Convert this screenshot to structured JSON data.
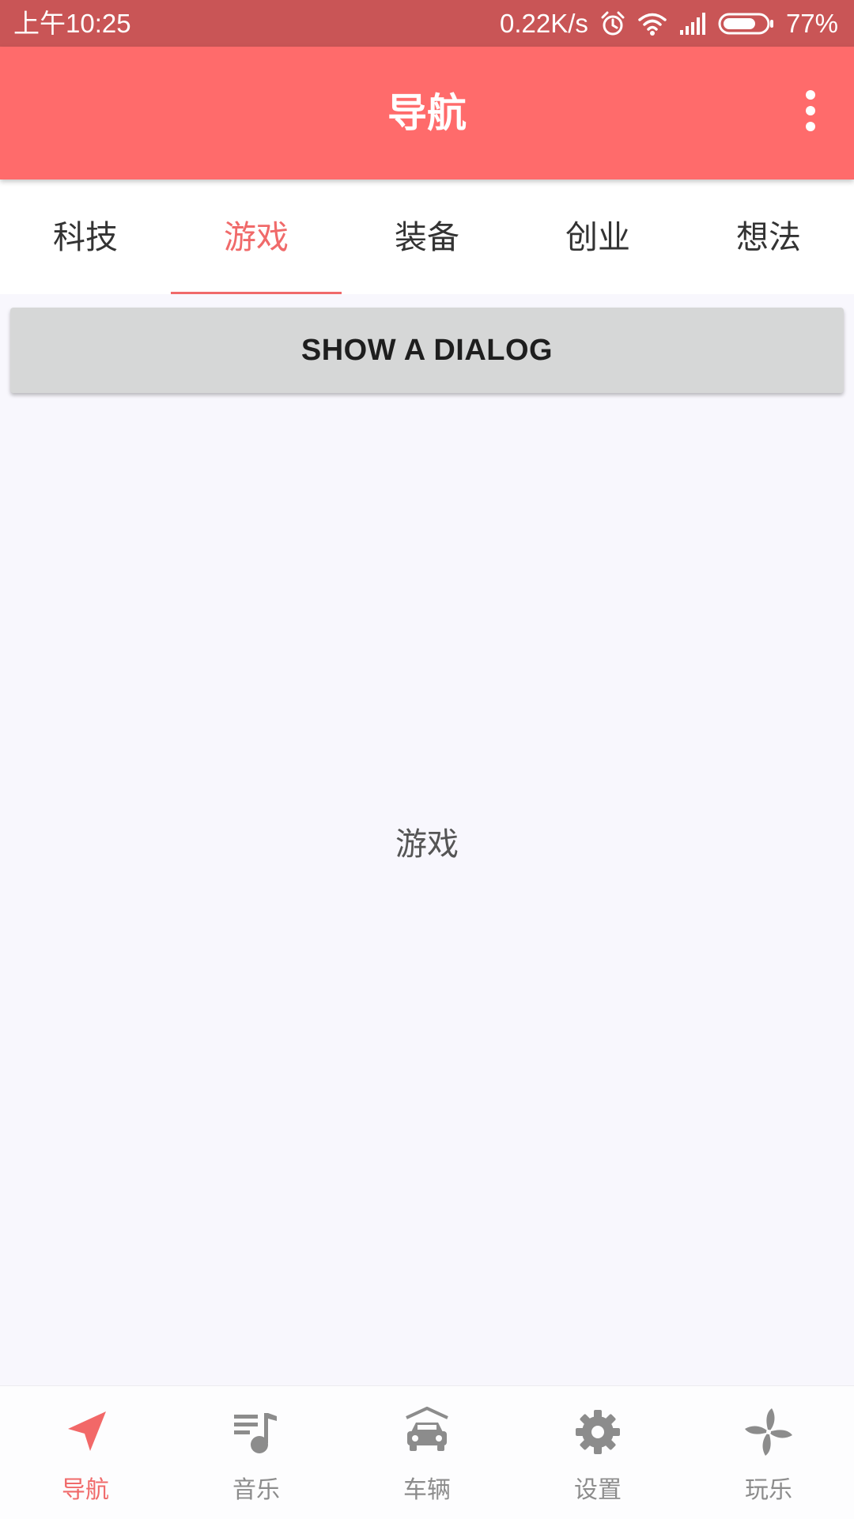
{
  "status_bar": {
    "time": "上午10:25",
    "network_speed": "0.22K/s",
    "battery_percent": "77%",
    "battery_level": 0.77,
    "icons": [
      "alarm-icon",
      "wifi-icon",
      "signal-icon",
      "battery-icon"
    ]
  },
  "app_bar": {
    "title": "导航",
    "menu_icon": "more-vert-icon"
  },
  "tabs": [
    {
      "label": "科技",
      "active": false
    },
    {
      "label": "游戏",
      "active": true
    },
    {
      "label": "装备",
      "active": false
    },
    {
      "label": "创业",
      "active": false
    },
    {
      "label": "想法",
      "active": false
    }
  ],
  "action_button": {
    "label": "SHOW A DIALOG"
  },
  "content": {
    "label": "游戏"
  },
  "bottom_nav": [
    {
      "label": "导航",
      "icon": "navigation-arrow-icon",
      "active": true
    },
    {
      "label": "音乐",
      "icon": "music-playlist-icon",
      "active": false
    },
    {
      "label": "车辆",
      "icon": "car-icon",
      "active": false
    },
    {
      "label": "设置",
      "icon": "gear-icon",
      "active": false
    },
    {
      "label": "玩乐",
      "icon": "pinwheel-icon",
      "active": false
    }
  ],
  "colors": {
    "status_bar": "#c95556",
    "app_bar": "#ff6b6b",
    "accent": "#f06a6a",
    "inactive_icon": "#8c8c8c",
    "button": "#d6d7d7",
    "background": "#f8f7fd"
  }
}
